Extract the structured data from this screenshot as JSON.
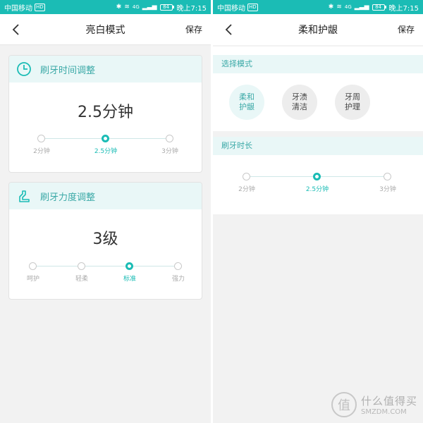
{
  "status_bar": {
    "carrier": "中国移动",
    "hd_badge": "HD",
    "network": "4G",
    "battery": "84",
    "time": "晚上7:15"
  },
  "left": {
    "title": "亮白模式",
    "save_label": "保存",
    "time_card": {
      "title": "刷牙时间调整",
      "value": "2.5分钟",
      "options": [
        "2分钟",
        "2.5分钟",
        "3分钟"
      ],
      "selected_index": 1
    },
    "force_card": {
      "title": "刷牙力度调整",
      "value": "3级",
      "options": [
        "呵护",
        "轻柔",
        "标准",
        "强力"
      ],
      "selected_index": 2
    }
  },
  "right": {
    "title": "柔和护龈",
    "save_label": "保存",
    "mode_section": {
      "label": "选择模式",
      "modes": [
        "柔和护龈",
        "牙渍清洁",
        "牙周护理"
      ],
      "selected_index": 0
    },
    "duration_section": {
      "label": "刷牙时长",
      "options": [
        "2分钟",
        "2.5分钟",
        "3分钟"
      ],
      "selected_index": 1
    }
  },
  "watermark": {
    "logo_char": "值",
    "name": "什么值得买",
    "domain": "SMZDM.COM"
  },
  "colors": {
    "accent": "#1bbcb5",
    "header_tint": "#e9f7f7",
    "card_title": "#3ba9a7"
  }
}
